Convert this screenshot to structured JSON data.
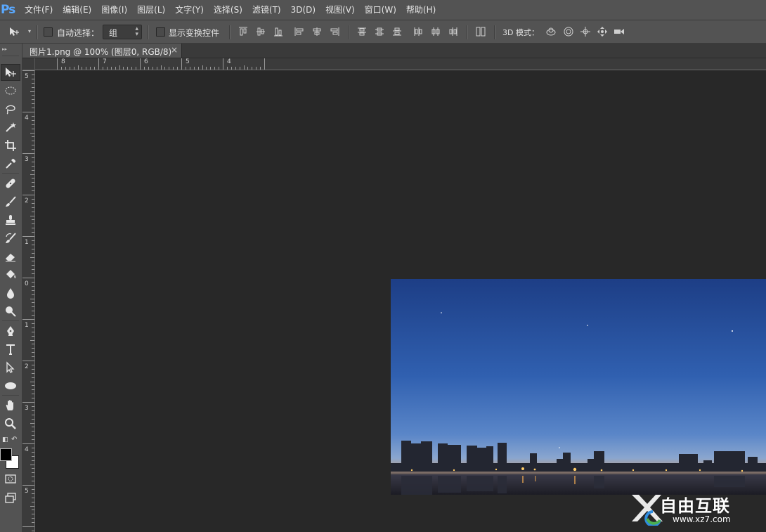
{
  "app": {
    "logo": "Ps"
  },
  "menu": [
    "文件(F)",
    "编辑(E)",
    "图像(I)",
    "图层(L)",
    "文字(Y)",
    "选择(S)",
    "滤镜(T)",
    "3D(D)",
    "视图(V)",
    "窗口(W)",
    "帮助(H)"
  ],
  "options": {
    "auto_select_label": "自动选择：",
    "auto_select_value": "组",
    "show_transform_label": "显示变换控件",
    "mode_3d_label": "3D 模式："
  },
  "document_tab": {
    "title": "图片1.png @ 100% (图层0, RGB/8)",
    "close": "×"
  },
  "rulers": {
    "horizontal": [
      "8",
      "7",
      "6",
      "5",
      "4"
    ],
    "vertical": [
      "5",
      "4",
      "3",
      "2",
      "1",
      "0",
      "1",
      "2",
      "3",
      "4",
      "5"
    ]
  },
  "tools": [
    "move-tool",
    "marquee-tool",
    "lasso-tool",
    "magic-wand-tool",
    "crop-tool",
    "eyedropper-tool",
    "healing-brush-tool",
    "brush-tool",
    "clone-stamp-tool",
    "history-brush-tool",
    "eraser-tool",
    "paint-bucket-tool",
    "blur-tool",
    "dodge-tool",
    "pen-tool",
    "type-tool",
    "path-selection-tool",
    "ellipse-tool",
    "hand-tool",
    "zoom-tool"
  ],
  "colors": {
    "foreground": "#000000",
    "background": "#ffffff",
    "panel": "#535353",
    "canvas_bg": "#282828",
    "sky_top": "#1d3e86",
    "sky_horizon": "#7a9bd0"
  },
  "watermark": {
    "text": "自由互联",
    "url": "www.xz7.com"
  }
}
